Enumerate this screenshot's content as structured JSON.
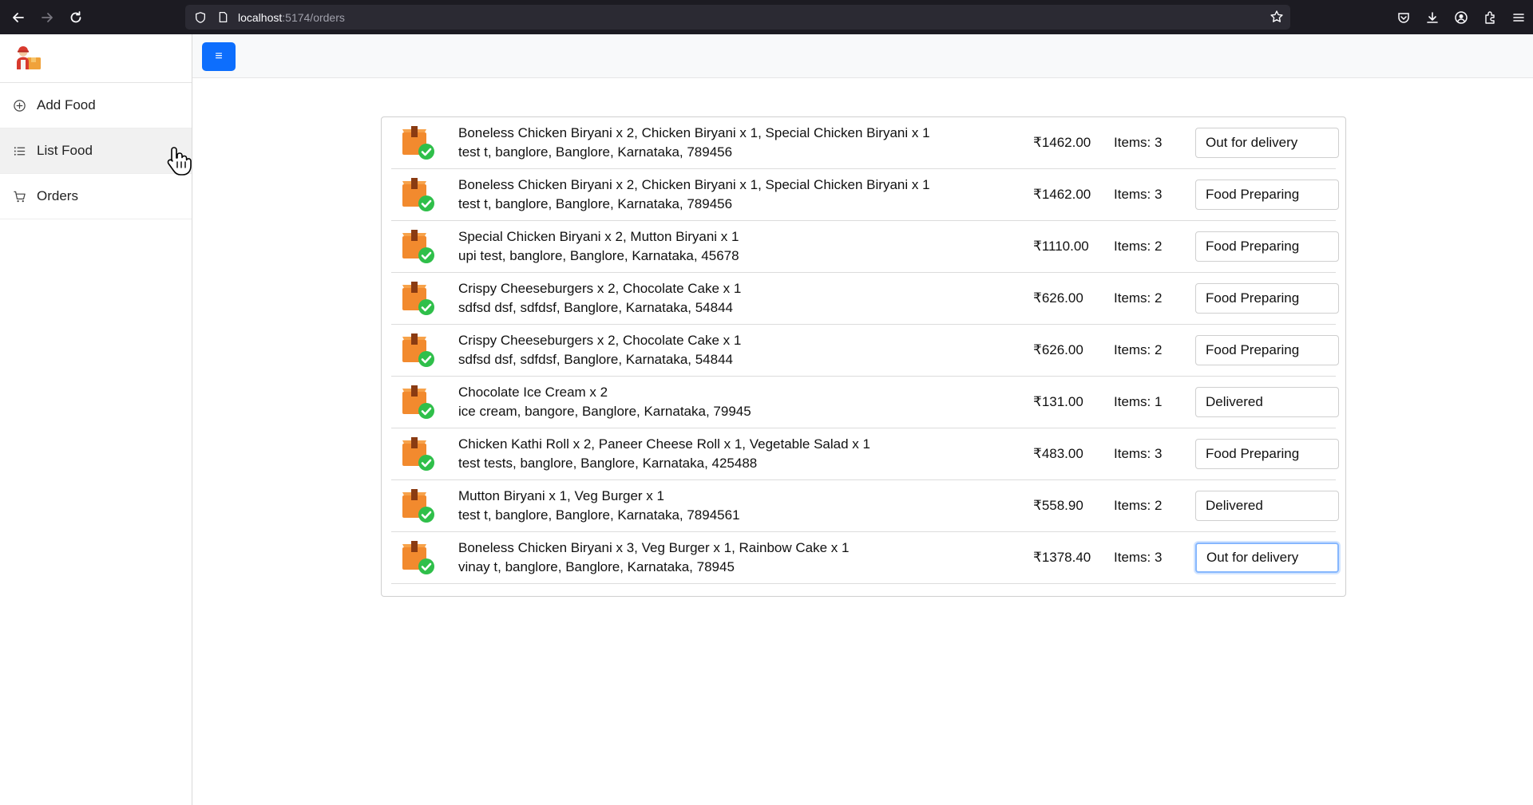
{
  "browser": {
    "url_host": "localhost",
    "url_path": ":5174/orders"
  },
  "sidebar": {
    "items": [
      {
        "label": "Add Food",
        "icon": "plus-circle-icon"
      },
      {
        "label": "List Food",
        "icon": "list-icon"
      },
      {
        "label": "Orders",
        "icon": "cart-icon"
      }
    ]
  },
  "topbar": {
    "menu_icon": "≡"
  },
  "orders": [
    {
      "items": "Boneless Chicken Biryani x 2, Chicken Biryani x 1, Special Chicken Biryani x 1",
      "address": "test t, banglore, Banglore, Karnataka, 789456",
      "amount": "₹1462.00",
      "count": "Items: 3",
      "status": "Out for delivery"
    },
    {
      "items": "Boneless Chicken Biryani x 2, Chicken Biryani x 1, Special Chicken Biryani x 1",
      "address": "test t, banglore, Banglore, Karnataka, 789456",
      "amount": "₹1462.00",
      "count": "Items: 3",
      "status": "Food Preparing"
    },
    {
      "items": "Special Chicken Biryani x 2, Mutton Biryani x 1",
      "address": "upi test, banglore, Banglore, Karnataka, 45678",
      "amount": "₹1110.00",
      "count": "Items: 2",
      "status": "Food Preparing"
    },
    {
      "items": "Crispy Cheeseburgers x 2, Chocolate Cake x 1",
      "address": "sdfsd dsf, sdfdsf, Banglore, Karnataka, 54844",
      "amount": "₹626.00",
      "count": "Items: 2",
      "status": "Food Preparing"
    },
    {
      "items": "Crispy Cheeseburgers x 2, Chocolate Cake x 1",
      "address": "sdfsd dsf, sdfdsf, Banglore, Karnataka, 54844",
      "amount": "₹626.00",
      "count": "Items: 2",
      "status": "Food Preparing"
    },
    {
      "items": "Chocolate Ice Cream x 2",
      "address": "ice cream, bangore, Banglore, Karnataka, 79945",
      "amount": "₹131.00",
      "count": "Items: 1",
      "status": "Delivered"
    },
    {
      "items": "Chicken Kathi Roll x 2, Paneer Cheese Roll x 1, Vegetable Salad x 1",
      "address": "test tests, banglore, Banglore, Karnataka, 425488",
      "amount": "₹483.00",
      "count": "Items: 3",
      "status": "Food Preparing"
    },
    {
      "items": "Mutton Biryani x 1, Veg Burger x 1",
      "address": "test t, banglore, Banglore, Karnataka, 7894561",
      "amount": "₹558.90",
      "count": "Items: 2",
      "status": "Delivered"
    },
    {
      "items": "Boneless Chicken Biryani x 3, Veg Burger x 1, Rainbow Cake x 1",
      "address": "vinay t, banglore, Banglore, Karnataka, 78945",
      "amount": "₹1378.40",
      "count": "Items: 3",
      "status": "Out for delivery"
    }
  ]
}
